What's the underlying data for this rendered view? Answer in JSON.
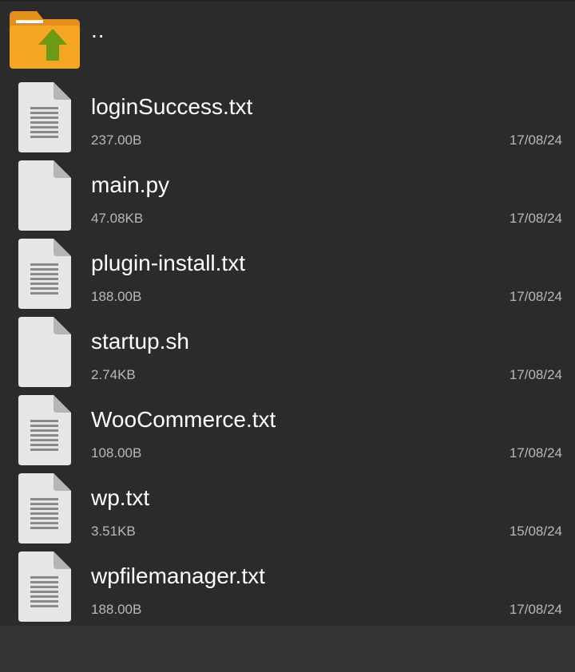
{
  "parent_dir": {
    "label": "..",
    "icon": "folder-up-icon"
  },
  "colors": {
    "background": "#2b2b2b",
    "folder": "#f5a623",
    "arrow": "#6b9a14",
    "file_icon": "#e6e6e6",
    "secondary_text": "#b8b8b8"
  },
  "files": [
    {
      "name": "loginSuccess.txt",
      "size": "237.00B",
      "date": "17/08/24",
      "icon": "text-file-icon"
    },
    {
      "name": "main.py",
      "size": "47.08KB",
      "date": "17/08/24",
      "icon": "blank-file-icon"
    },
    {
      "name": "plugin-install.txt",
      "size": "188.00B",
      "date": "17/08/24",
      "icon": "text-file-icon"
    },
    {
      "name": "startup.sh",
      "size": "2.74KB",
      "date": "17/08/24",
      "icon": "blank-file-icon"
    },
    {
      "name": "WooCommerce.txt",
      "size": "108.00B",
      "date": "17/08/24",
      "icon": "text-file-icon"
    },
    {
      "name": "wp.txt",
      "size": "3.51KB",
      "date": "15/08/24",
      "icon": "text-file-icon"
    },
    {
      "name": "wpfilemanager.txt",
      "size": "188.00B",
      "date": "17/08/24",
      "icon": "text-file-icon"
    }
  ]
}
